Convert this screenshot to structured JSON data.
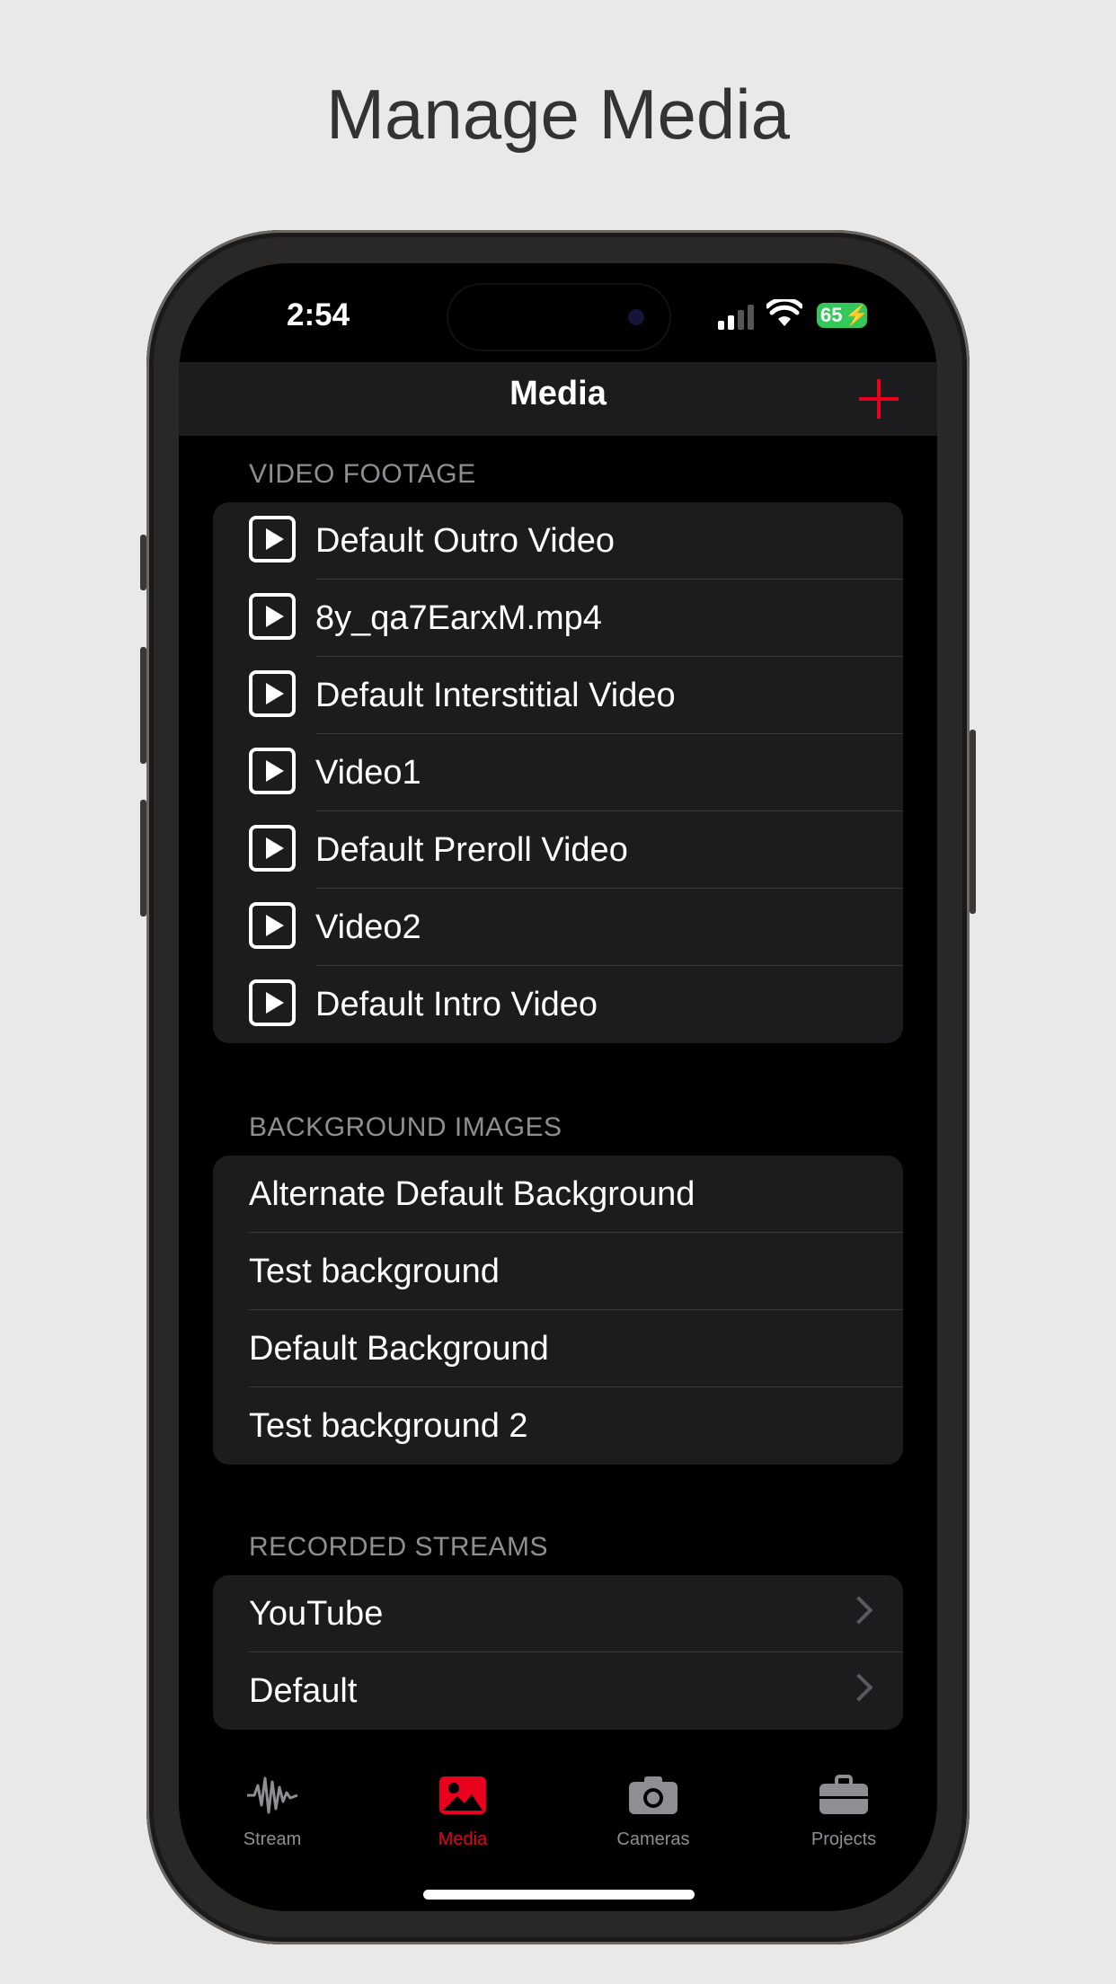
{
  "headline": "Manage Media",
  "status": {
    "time": "2:54",
    "battery": "65"
  },
  "nav": {
    "title": "Media"
  },
  "sections": {
    "video": {
      "header": "VIDEO FOOTAGE",
      "items": [
        "Default Outro Video",
        "8y_qa7EarxM.mp4",
        "Default Interstitial Video",
        "Video1",
        "Default Preroll Video",
        "Video2",
        "Default Intro Video"
      ]
    },
    "backgrounds": {
      "header": "BACKGROUND IMAGES",
      "items": [
        "Alternate Default Background",
        "Test background",
        "Default Background",
        "Test background 2"
      ]
    },
    "recorded": {
      "header": "RECORDED STREAMS",
      "items": [
        "YouTube",
        "Default"
      ]
    }
  },
  "tabs": [
    {
      "label": "Stream",
      "icon": "waveform-icon"
    },
    {
      "label": "Media",
      "icon": "photo-icon"
    },
    {
      "label": "Cameras",
      "icon": "camera-icon"
    },
    {
      "label": "Projects",
      "icon": "briefcase-icon"
    }
  ],
  "colors": {
    "accent": "#e8001c",
    "background": "#000000",
    "cell": "#1c1c1e",
    "secondary_text": "#8e8e93"
  }
}
